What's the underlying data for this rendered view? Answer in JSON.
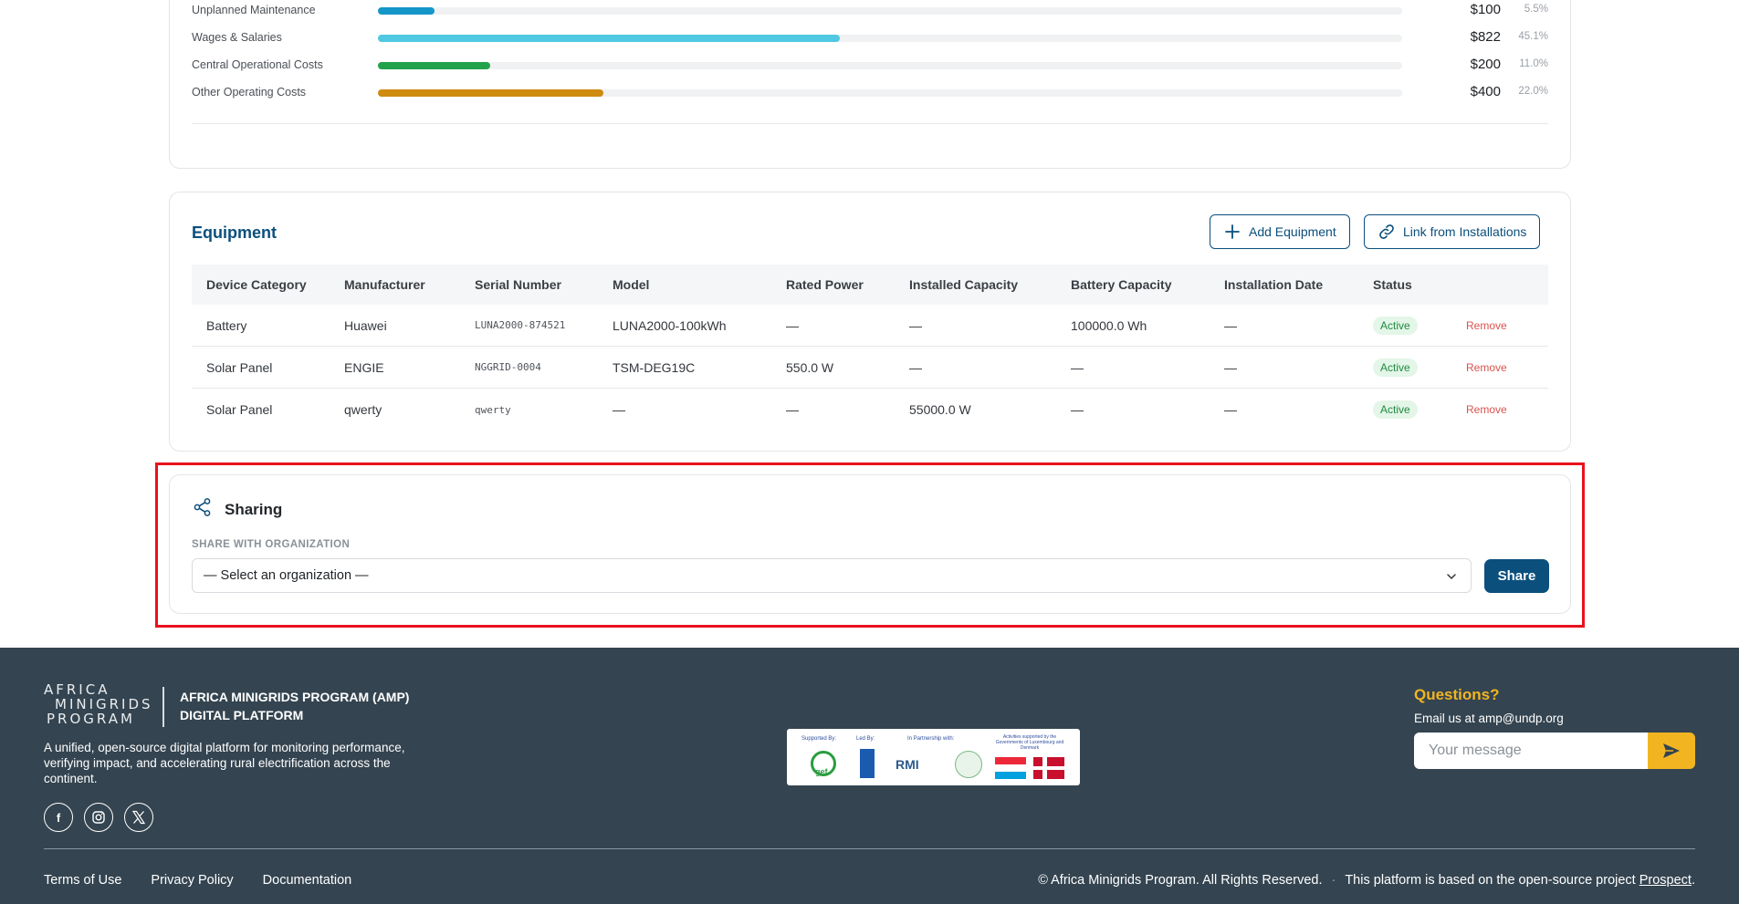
{
  "cost_breakdown": {
    "rows": [
      {
        "label": "Unplanned Maintenance",
        "amount": "$100",
        "pct": "5.5%",
        "fraction": 0.055,
        "color": "#1596c8"
      },
      {
        "label": "Wages & Salaries",
        "amount": "$822",
        "pct": "45.1%",
        "fraction": 0.451,
        "color": "#4fc8e2"
      },
      {
        "label": "Central Operational Costs",
        "amount": "$200",
        "pct": "11.0%",
        "fraction": 0.11,
        "color": "#22a24b"
      },
      {
        "label": "Other Operating Costs",
        "amount": "$400",
        "pct": "22.0%",
        "fraction": 0.22,
        "color": "#cf8a10"
      }
    ]
  },
  "equipment": {
    "title": "Equipment",
    "add_label": "Add Equipment",
    "link_label": "Link from Installations",
    "columns": [
      "Device Category",
      "Manufacturer",
      "Serial Number",
      "Model",
      "Rated Power",
      "Installed Capacity",
      "Battery Capacity",
      "Installation Date",
      "Status"
    ],
    "rows": [
      {
        "category": "Battery",
        "manufacturer": "Huawei",
        "serial": "LUNA2000-874521",
        "model": "LUNA2000-100kWh",
        "rated_power": "—",
        "installed_capacity": "—",
        "battery_capacity": "100000.0 Wh",
        "installation_date": "—",
        "status": "Active",
        "action": "Remove"
      },
      {
        "category": "Solar Panel",
        "manufacturer": "ENGIE",
        "serial": "NGGRID-0004",
        "model": "TSM-DEG19C",
        "rated_power": "550.0 W",
        "installed_capacity": "—",
        "battery_capacity": "—",
        "installation_date": "—",
        "status": "Active",
        "action": "Remove"
      },
      {
        "category": "Solar Panel",
        "manufacturer": "qwerty",
        "serial": "qwerty",
        "model": "—",
        "rated_power": "—",
        "installed_capacity": "55000.0 W",
        "battery_capacity": "—",
        "installation_date": "—",
        "status": "Active",
        "action": "Remove"
      }
    ]
  },
  "sharing": {
    "title": "Sharing",
    "field_label": "SHARE WITH ORGANIZATION",
    "select_value": "— Select an organization —",
    "button_label": "Share"
  },
  "footer": {
    "logo_lines": [
      "AFRICA",
      "MINIGRIDS",
      "PROGRAM"
    ],
    "brand_line1": "AFRICA MINIGRIDS PROGRAM (AMP)",
    "brand_line2": "DIGITAL PLATFORM",
    "description": "A unified, open-source digital platform for monitoring performance, verifying impact, and accelerating rural electrification across the continent.",
    "socials": [
      "facebook-icon",
      "instagram-icon",
      "x-icon"
    ],
    "partners": {
      "supported_by": "Supported By:",
      "led_by": "Led By:",
      "partnership": "In Partnership with:",
      "activities": "Activities supported by the Governments of Luxembourg and Denmark",
      "gef": "gef",
      "rmi": "RMI"
    },
    "questions_title": "Questions?",
    "questions_email": "Email us at amp@undp.org",
    "message_placeholder": "Your message",
    "links": [
      "Terms of Use",
      "Privacy Policy",
      "Documentation"
    ],
    "copyright": "© Africa Minigrids Program. All Rights Reserved.",
    "separator": "·",
    "based_on": "This platform is based on the open-source project",
    "prospect_link": "Prospect",
    "period": "."
  }
}
